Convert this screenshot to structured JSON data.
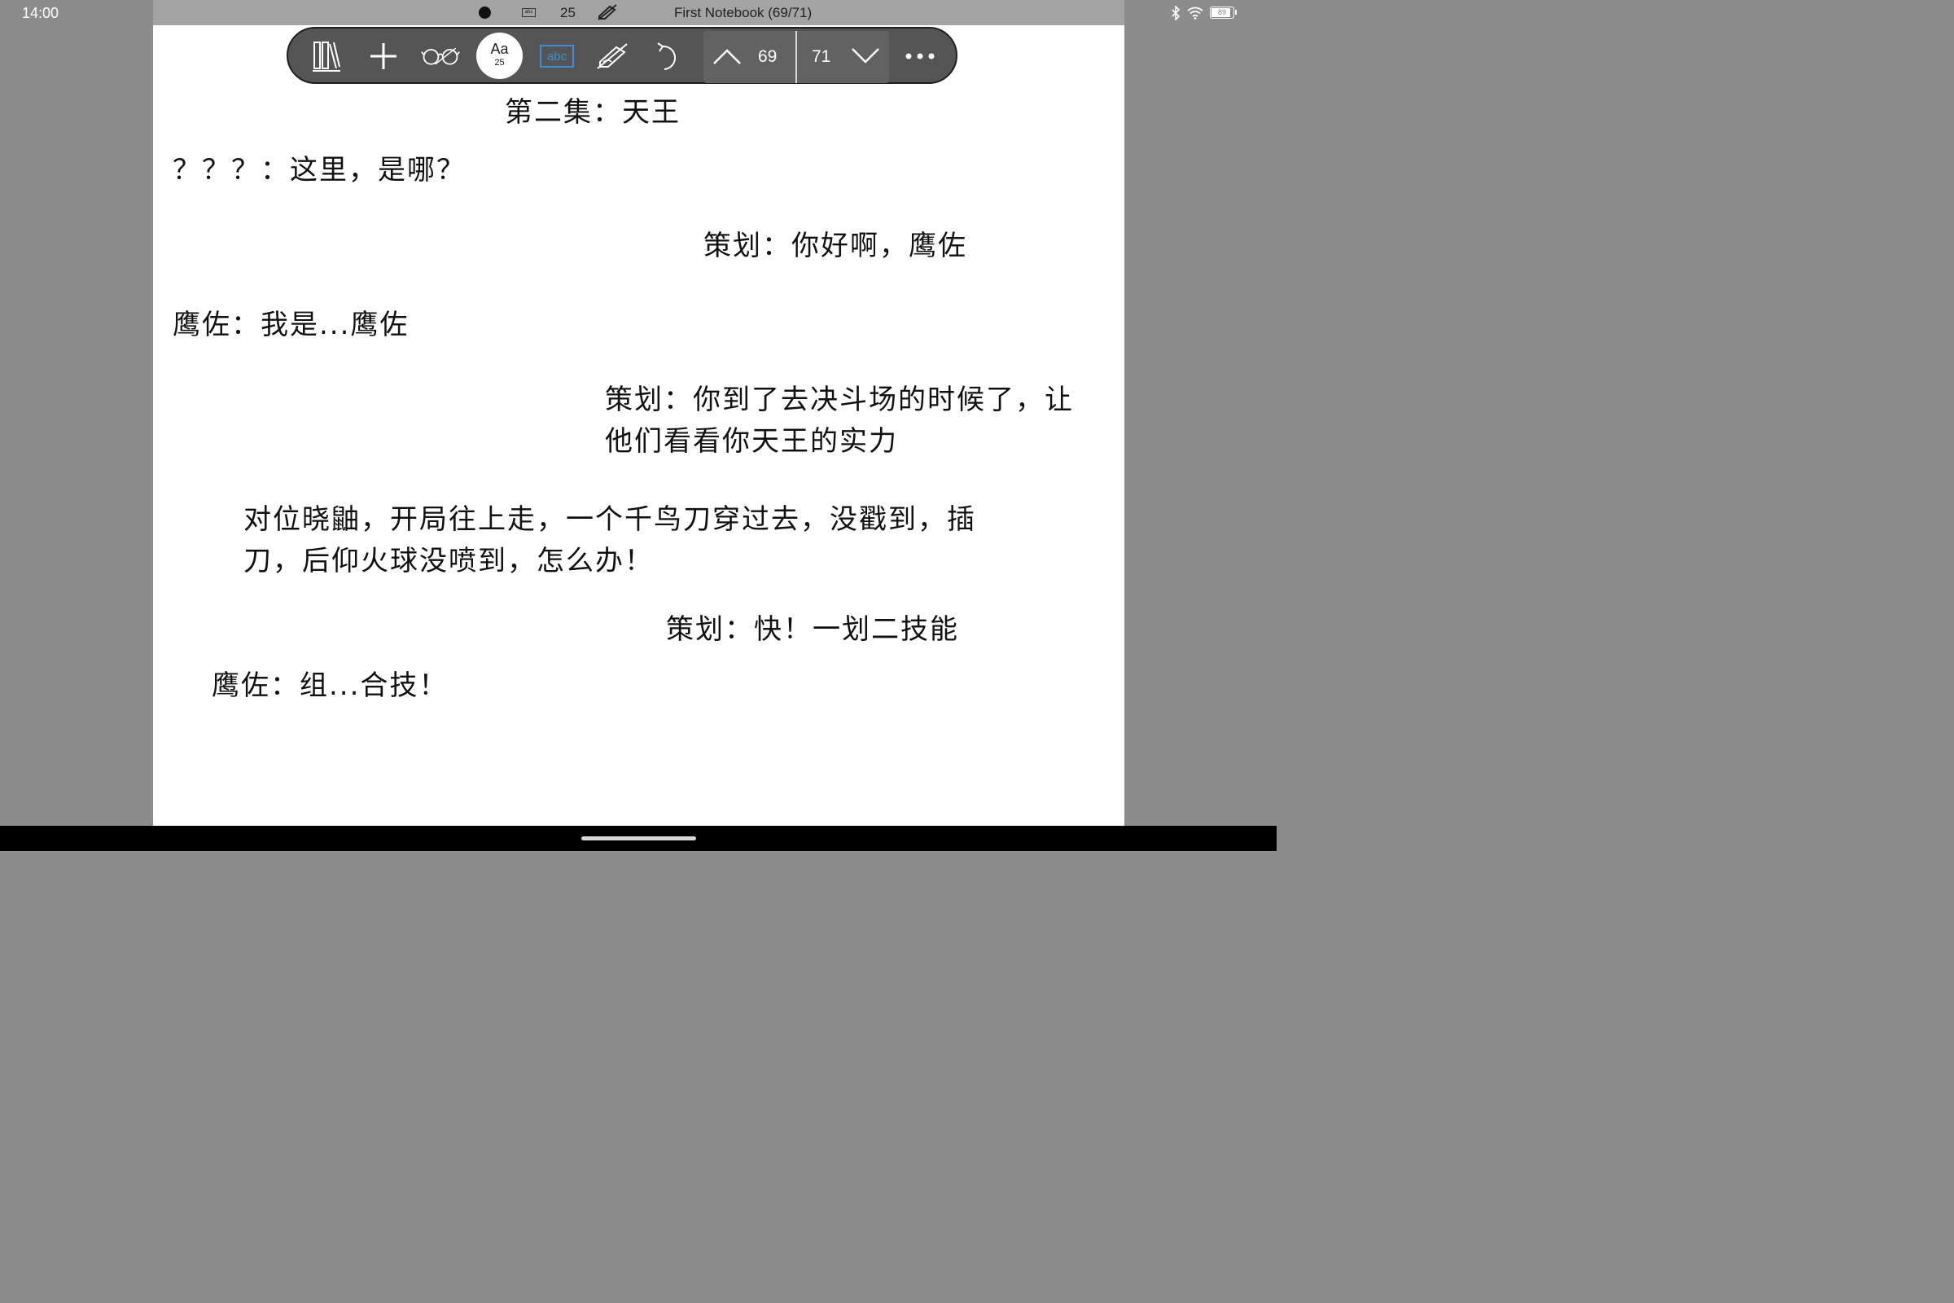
{
  "status_bar": {
    "time": "14:00",
    "font_size": "25",
    "abc_label": "abc",
    "document_title": "First Notebook (69/71)",
    "battery": "89"
  },
  "toolbar": {
    "font_button": {
      "label": "Aa",
      "size": "25"
    },
    "abc_label": "abc",
    "current_page": "69",
    "total_pages": "71"
  },
  "document": {
    "heading": "第二集：天王",
    "lines": [
      "？？？：这里，是哪？",
      "策划：你好啊，鹰佐",
      "鹰佐：我是...鹰佐",
      "策划：你到了去决斗场的时候了，让",
      "他们看看你天王的实力",
      "对位晓鼬，开局往上走，一个千鸟刀穿过去，没戳到，插",
      "刀，后仰火球没喷到，怎么办！",
      "策划：快！一划二技能",
      "鹰佐：组...合技！"
    ]
  },
  "colors": {
    "toolbar_bg": "#555555",
    "abc_accent": "#3a8fd6",
    "page_bg": "#ffffff",
    "margin_bg": "#8c8c8c"
  }
}
